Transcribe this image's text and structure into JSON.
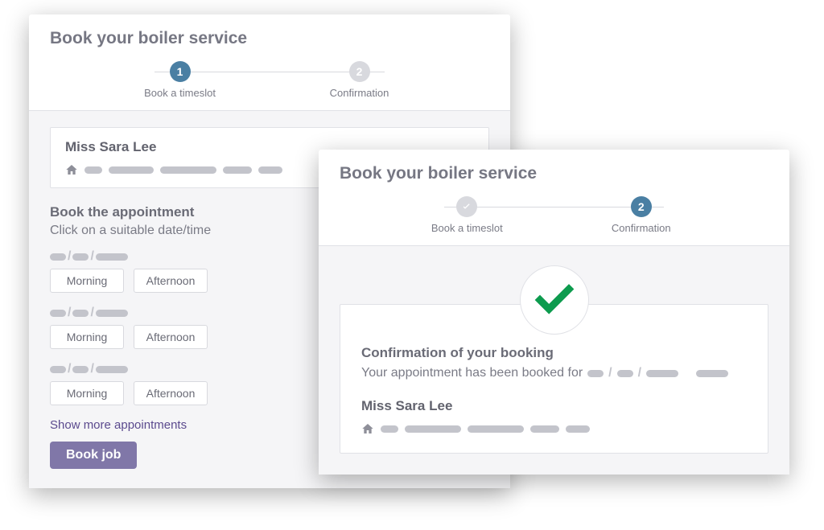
{
  "left": {
    "title": "Book your boiler service",
    "steps": [
      {
        "num": "1",
        "label": "Book a timeslot",
        "state": "active"
      },
      {
        "num": "2",
        "label": "Confirmation",
        "state": "inactive"
      }
    ],
    "customer_name": "Miss Sara Lee",
    "section_title": "Book the appointment",
    "section_subtitle": "Click on a suitable date/time",
    "slots": [
      {
        "morning": "Morning",
        "afternoon": "Afternoon"
      },
      {
        "morning": "Morning",
        "afternoon": "Afternoon"
      },
      {
        "morning": "Morning",
        "afternoon": "Afternoon"
      }
    ],
    "show_more": "Show more appointments",
    "book_btn": "Book job"
  },
  "right": {
    "title": "Book your boiler service",
    "steps": [
      {
        "label": "Book a timeslot",
        "state": "done"
      },
      {
        "num": "2",
        "label": "Confirmation",
        "state": "active"
      }
    ],
    "confirm_title": "Confirmation of your booking",
    "confirm_text": "Your appointment has been booked for",
    "customer_name": "Miss Sara Lee"
  }
}
